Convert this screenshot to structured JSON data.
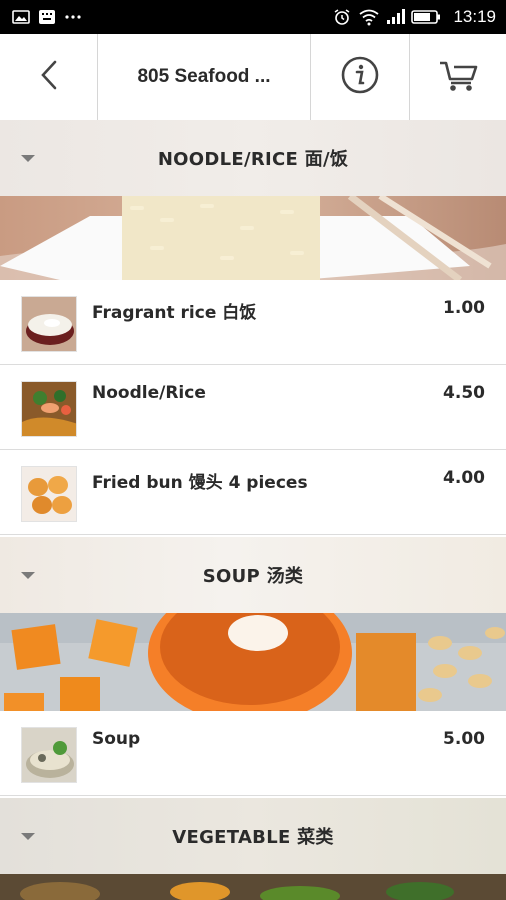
{
  "status_bar": {
    "time": "13:19",
    "left_icons": [
      "image-icon",
      "keyboard-icon",
      "more-icon"
    ],
    "right_icons": [
      "alarm-icon",
      "wifi-icon",
      "signal-icon",
      "battery-icon"
    ]
  },
  "app_bar": {
    "title": "805 Seafood ...",
    "back_icon": "back-arrow-icon",
    "info_icon": "info-icon",
    "cart_icon": "cart-icon"
  },
  "categories": [
    {
      "label": "NOODLE/RICE 面/饭",
      "items": [
        {
          "name": "Fragrant rice 白饭",
          "price": "1.00",
          "thumb": "rice-bowl-thumbnail"
        },
        {
          "name": "Noodle/Rice",
          "price": "4.50",
          "thumb": "noodles-thumbnail"
        },
        {
          "name": "Fried bun 馒头 4 pieces",
          "price": "4.00",
          "thumb": "fried-buns-thumbnail"
        }
      ]
    },
    {
      "label": "SOUP 汤类",
      "items": [
        {
          "name": "Soup",
          "price": "5.00",
          "thumb": "soup-thumbnail"
        }
      ]
    },
    {
      "label": "VEGETABLE 菜类",
      "items": []
    }
  ],
  "colors": {
    "status_bar_bg": "#000000",
    "text_dark": "#2a2a2a",
    "divider": "#dcdcdc"
  }
}
